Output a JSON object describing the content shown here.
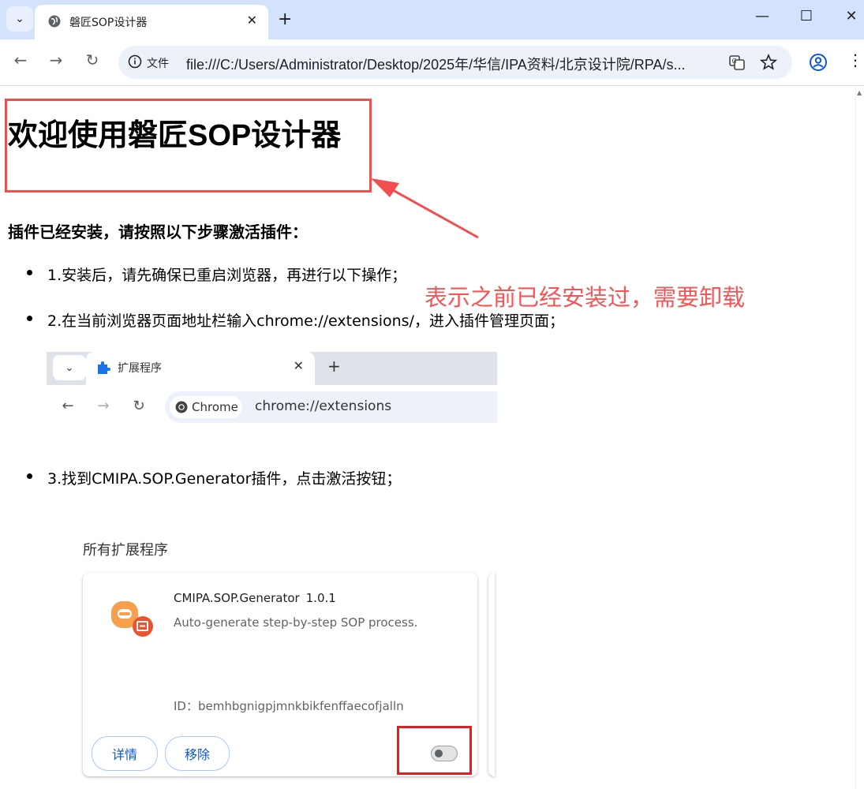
{
  "browser": {
    "tab_title": "磐匠SOP设计器",
    "site_chip": "文件",
    "url": "file:///C:/Users/Administrator/Desktop/2025年/华信/IPA资料/北京设计院/RPA/s...",
    "tab_menu_icon": "chevron-down-icon",
    "window_controls": [
      "minimize-icon",
      "maximize-icon",
      "close-icon"
    ]
  },
  "page": {
    "title": "欢迎使用磐匠SOP设计器",
    "instruction": "插件已经安装，请按照以下步骤激活插件：",
    "steps": [
      "1.安装后，请先确保已重启浏览器，再进行以下操作；",
      "2.在当前浏览器页面地址栏输入chrome://extensions/，进入插件管理页面；",
      "3.找到CMIPA.SOP.Generator插件，点击激活按钮；"
    ],
    "annotation": "表示之前已经安装过，需要卸载",
    "annotation_color": "#f25656"
  },
  "example_browser": {
    "tab_title": "扩展程序",
    "chip_label": "Chrome",
    "url": "chrome://extensions"
  },
  "extensions_panel": {
    "section_label": "所有扩展程序",
    "extension": {
      "name": "CMIPA.SOP.Generator",
      "version": "1.0.1",
      "description": "Auto-generate step-by-step SOP process.",
      "id_text": "ID：bemhbgnigpjmnkbikfenffaecofjalln",
      "details_button": "详情",
      "remove_button": "移除",
      "enabled": false
    },
    "highlight_color": "#e02020"
  }
}
